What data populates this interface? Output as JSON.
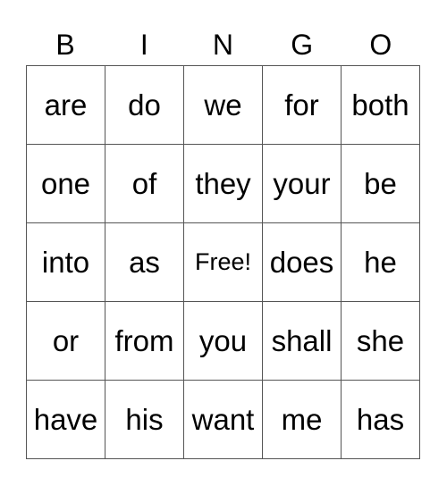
{
  "header": {
    "letters": [
      "B",
      "I",
      "N",
      "G",
      "O"
    ]
  },
  "grid": {
    "rows": [
      [
        "are",
        "do",
        "we",
        "for",
        "both"
      ],
      [
        "one",
        "of",
        "they",
        "your",
        "be"
      ],
      [
        "into",
        "as",
        "Free!",
        "does",
        "he"
      ],
      [
        "or",
        "from",
        "you",
        "shall",
        "she"
      ],
      [
        "have",
        "his",
        "want",
        "me",
        "has"
      ]
    ],
    "free_space": {
      "row": 2,
      "col": 2
    }
  }
}
